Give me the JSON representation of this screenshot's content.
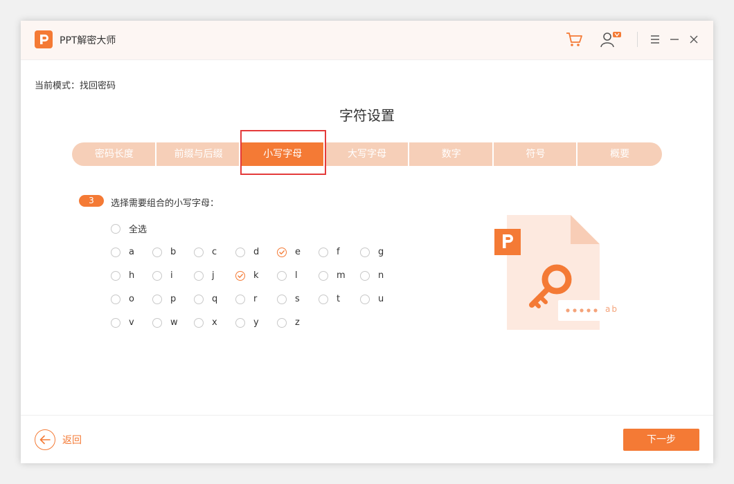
{
  "app": {
    "title": "PPT解密大师"
  },
  "mode_label": "当前模式：找回密码",
  "section_title": "字符设置",
  "steps": [
    "密码长度",
    "前缀与后缀",
    "小写字母",
    "大写字母",
    "数字",
    "符号",
    "概要"
  ],
  "active_step": 2,
  "instruction": {
    "number": "3",
    "text": "选择需要组合的小写字母："
  },
  "select_all": {
    "label": "全选",
    "checked": false
  },
  "letters": [
    {
      "label": "a",
      "checked": false
    },
    {
      "label": "b",
      "checked": false
    },
    {
      "label": "c",
      "checked": false
    },
    {
      "label": "d",
      "checked": false
    },
    {
      "label": "e",
      "checked": true
    },
    {
      "label": "f",
      "checked": false
    },
    {
      "label": "g",
      "checked": false
    },
    {
      "label": "h",
      "checked": false
    },
    {
      "label": "i",
      "checked": false
    },
    {
      "label": "j",
      "checked": false
    },
    {
      "label": "k",
      "checked": true
    },
    {
      "label": "l",
      "checked": false
    },
    {
      "label": "m",
      "checked": false
    },
    {
      "label": "n",
      "checked": false
    },
    {
      "label": "o",
      "checked": false
    },
    {
      "label": "p",
      "checked": false
    },
    {
      "label": "q",
      "checked": false
    },
    {
      "label": "r",
      "checked": false
    },
    {
      "label": "s",
      "checked": false
    },
    {
      "label": "t",
      "checked": false
    },
    {
      "label": "u",
      "checked": false
    },
    {
      "label": "v",
      "checked": false
    },
    {
      "label": "w",
      "checked": false
    },
    {
      "label": "x",
      "checked": false
    },
    {
      "label": "y",
      "checked": false
    },
    {
      "label": "z",
      "checked": false
    }
  ],
  "illustration": {
    "password_text": "ab"
  },
  "footer": {
    "back_label": "返回",
    "next_label": "下一步"
  },
  "icons": {
    "cart": "cart-icon",
    "user": "user-vip-icon",
    "menu": "menu-icon",
    "minimize": "minimize-icon",
    "close": "close-icon",
    "back": "arrow-left-icon"
  },
  "colors": {
    "accent": "#f47a35",
    "step_inactive": "#f6cfb8",
    "highlight": "#e43a3a"
  }
}
